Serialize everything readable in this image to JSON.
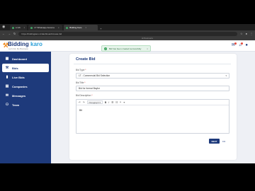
{
  "browser": {
    "tabs": [
      {
        "label": "Lt Mi",
        "active": false
      },
      {
        "label": "LT Whatsapp Automa",
        "active": false
      },
      {
        "label": "Bidding Karo",
        "active": true
      }
    ],
    "url": "https://biddingkaro.in/dashboard/create-bid",
    "bookmarks_label": "All Bookmarks"
  },
  "header": {
    "brand_main": "Bidding",
    "brand_accent": "karo",
    "tagline": "Let's bid, My Business"
  },
  "toast": {
    "check": "✓",
    "message": "Bid has been created successfully",
    "close": "×"
  },
  "sidebar": {
    "items": [
      {
        "label": "Dashboard",
        "icon": "grid-icon",
        "glyph": "▦"
      },
      {
        "label": "Bids",
        "icon": "gavel-icon",
        "glyph": "⚒"
      },
      {
        "label": "Live Bids",
        "icon": "chart-icon",
        "glyph": "▮"
      },
      {
        "label": "Companies",
        "icon": "building-icon",
        "glyph": "▤"
      },
      {
        "label": "Messages",
        "icon": "chat-icon",
        "glyph": "✉"
      },
      {
        "label": "Team",
        "icon": "team-icon",
        "glyph": "⚇"
      }
    ]
  },
  "form": {
    "title": "Create Bid",
    "bid_type_label": "Bid Type",
    "bid_type_value": "LT - Commercial Bid Selection",
    "bid_title_label": "Bid Title",
    "bid_title_value": "Bid for format Baylor",
    "bid_description_label": "Bid Description",
    "paragraph_option": "Paragraph",
    "description_text": "Bit",
    "next_button": "NEXT",
    "pager": "•••"
  },
  "colors": {
    "brand_navy": "#1e3a7b",
    "brand_orange": "#f08a1c",
    "brand_blue": "#2da0d8",
    "toast_green": "#3aa35b"
  }
}
